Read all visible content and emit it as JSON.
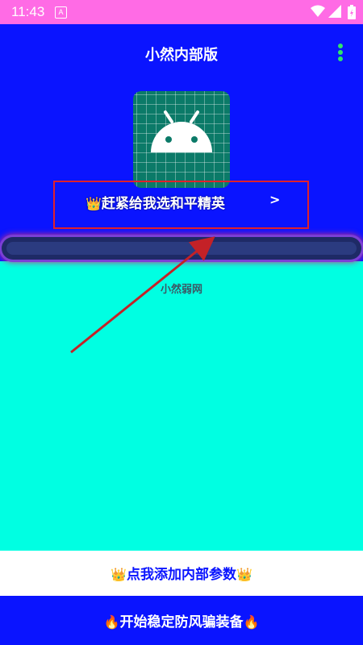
{
  "status_bar": {
    "time": "11:43",
    "notification_badge": "A"
  },
  "header": {
    "title": "小然内部版"
  },
  "promo": {
    "crown": "👑",
    "label": "赶紧给我选和平精英",
    "arrow": ">"
  },
  "progress": {
    "value_fraction": 1.0
  },
  "body": {
    "subtitle": "小然弱网"
  },
  "buttons": {
    "add_params": {
      "label": "点我添加内部参数",
      "left_emoji": "👑",
      "right_emoji": "👑"
    },
    "start": {
      "label": "开始稳定防风骗装备",
      "left_emoji": "🔥",
      "right_emoji": "🔥"
    }
  },
  "colors": {
    "header_bg": "#0A14FF",
    "body_bg": "#00FFE2",
    "status_bar_bg": "#FF6BE5",
    "promo_border": "#E0212B",
    "menu_dots": "#2EE56B"
  },
  "icons": [
    "wifi-icon",
    "signal-icon",
    "battery-icon",
    "overflow-menu-icon",
    "android-app-icon"
  ]
}
